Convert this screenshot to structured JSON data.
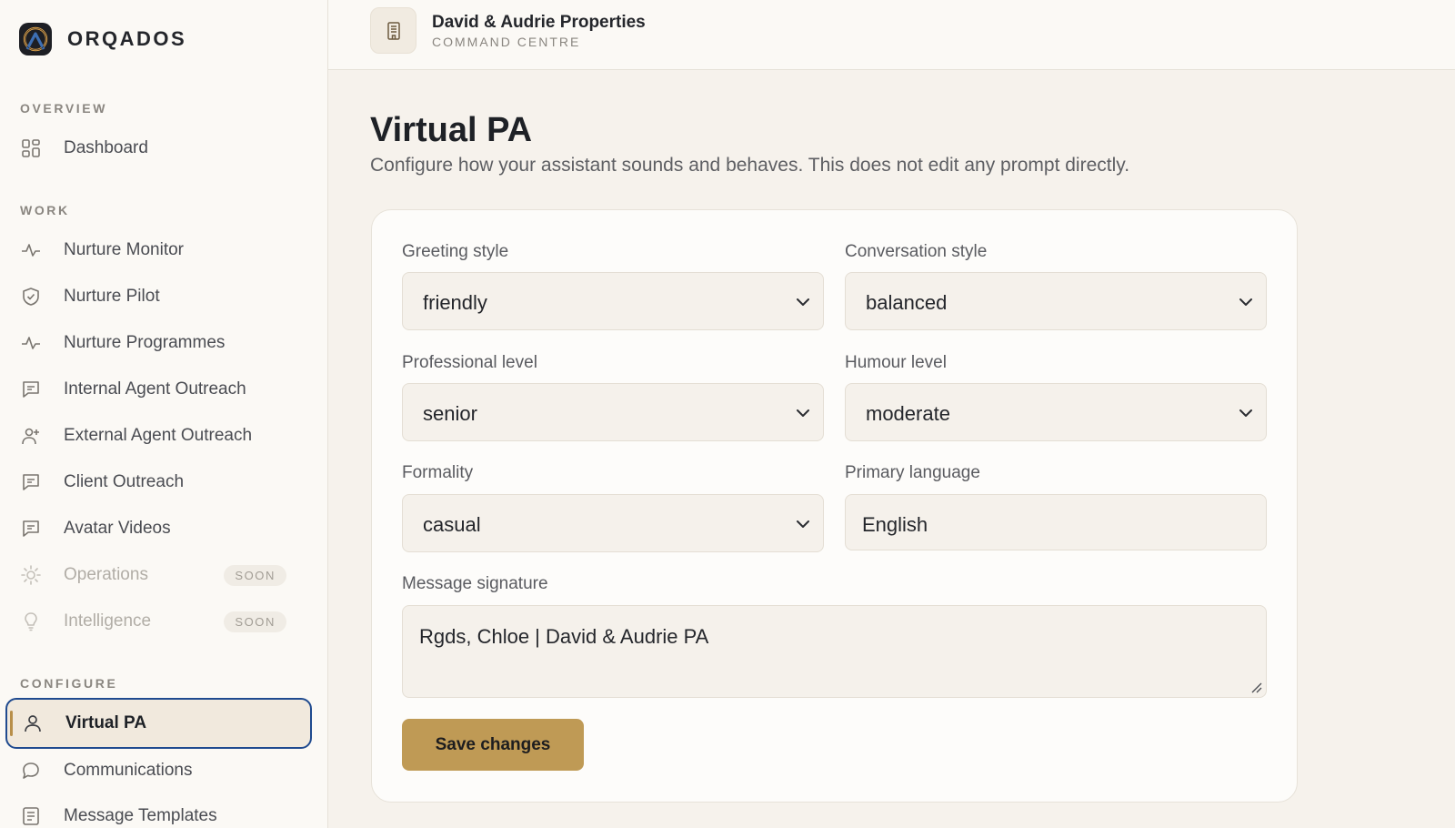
{
  "brand": {
    "name": "ORQADOS"
  },
  "sidebar": {
    "sections": [
      {
        "label": "OVERVIEW"
      },
      {
        "label": "WORK"
      },
      {
        "label": "CONFIGURE"
      }
    ],
    "items": [
      {
        "label": "Dashboard",
        "icon": "grid-icon"
      },
      {
        "label": "Nurture Monitor",
        "icon": "pulse-icon"
      },
      {
        "label": "Nurture Pilot",
        "icon": "shield-icon"
      },
      {
        "label": "Nurture Programmes",
        "icon": "pulse-icon"
      },
      {
        "label": "Internal Agent Outreach",
        "icon": "message-square-icon"
      },
      {
        "label": "External Agent Outreach",
        "icon": "user-plus-icon"
      },
      {
        "label": "Client Outreach",
        "icon": "message-square-icon"
      },
      {
        "label": "Avatar Videos",
        "icon": "message-square-icon"
      },
      {
        "label": "Operations",
        "icon": "sun-icon",
        "badge": "SOON",
        "disabled": true
      },
      {
        "label": "Intelligence",
        "icon": "lightbulb-icon",
        "badge": "SOON",
        "disabled": true
      },
      {
        "label": "Virtual PA",
        "icon": "user-icon",
        "active": true
      },
      {
        "label": "Communications",
        "icon": "chat-bubble-icon"
      },
      {
        "label": "Message Templates",
        "icon": "document-icon"
      }
    ]
  },
  "header": {
    "org_name": "David & Audrie Properties",
    "org_subtitle": "COMMAND CENTRE"
  },
  "main": {
    "title": "Virtual PA",
    "subtitle": "Configure how your assistant sounds and behaves. This does not edit any prompt directly.",
    "fields": {
      "greeting_style": {
        "label": "Greeting style",
        "value": "friendly"
      },
      "conversation_style": {
        "label": "Conversation style",
        "value": "balanced"
      },
      "professional_level": {
        "label": "Professional level",
        "value": "senior"
      },
      "humour_level": {
        "label": "Humour level",
        "value": "moderate"
      },
      "formality": {
        "label": "Formality",
        "value": "casual"
      },
      "primary_language": {
        "label": "Primary language",
        "value": "English"
      },
      "message_signature": {
        "label": "Message signature",
        "value": "Rgds, Chloe | David & Audrie PA"
      }
    },
    "save_label": "Save changes"
  },
  "colors": {
    "accent": "#bf9a55",
    "focus_ring": "#1f4a8f",
    "background": "#f6f2ec"
  }
}
